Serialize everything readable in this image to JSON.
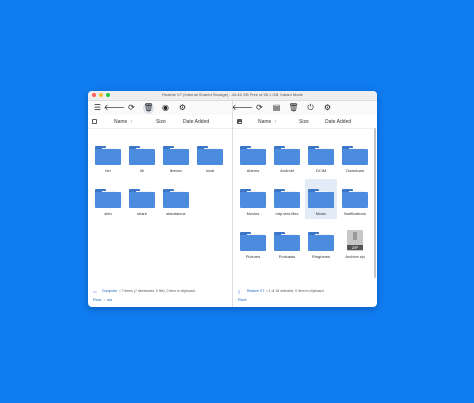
{
  "window": {
    "title": "Realme X7 (Internal Shared Storage) - 44.46 GB Free of 55.1 GB, Kalam Mode",
    "traffic_colors": [
      "#fe5f57",
      "#febc2e",
      "#28c840"
    ]
  },
  "left": {
    "header": {
      "name": "Name",
      "size": "Size",
      "date": "Date Added"
    },
    "items": [
      {
        "label": "bin",
        "kind": "folder"
      },
      {
        "label": "lib",
        "kind": "folder"
      },
      {
        "label": "libexec",
        "kind": "folder"
      },
      {
        "label": "local",
        "kind": "folder"
      },
      {
        "label": "sbin",
        "kind": "folder"
      },
      {
        "label": "share",
        "kind": "folder"
      },
      {
        "label": "standalone",
        "kind": "folder"
      }
    ],
    "status": {
      "source": "Computer",
      "text": "• 7 items (7 directories, 0 file), 0 item in clipboard"
    },
    "breadcrumb": {
      "root": "Root",
      "sep": "›",
      "current": "usr"
    }
  },
  "right": {
    "header": {
      "name": "Name",
      "size": "Size",
      "date": "Date Added"
    },
    "items": [
      {
        "label": "Alarms",
        "kind": "folder"
      },
      {
        "label": "Android",
        "kind": "folder"
      },
      {
        "label": "DCIM",
        "kind": "folder"
      },
      {
        "label": "Download",
        "kind": "folder"
      },
      {
        "label": "Movies",
        "kind": "folder"
      },
      {
        "label": "mtp-test-files",
        "kind": "folder"
      },
      {
        "label": "Music",
        "kind": "folder",
        "selected": true
      },
      {
        "label": "Notifications",
        "kind": "folder"
      },
      {
        "label": "Pictures",
        "kind": "folder"
      },
      {
        "label": "Podcasts",
        "kind": "folder"
      },
      {
        "label": "Ringtones",
        "kind": "folder"
      },
      {
        "label": "Archive.zip",
        "kind": "zip",
        "badge": "ZIP"
      }
    ],
    "status": {
      "source": "Realme X7",
      "text": "• 1 of 16 selected, 0 item in clipboard"
    },
    "breadcrumb": {
      "root": "Root"
    }
  },
  "icons": {
    "menu": "☰",
    "back": "🡐",
    "refresh": "⟳",
    "trash": "🗑",
    "github": "◉",
    "settings": "⚙",
    "sd": "▤",
    "plug": "⏻",
    "sort": "↑",
    "computer": "▭",
    "phone": "▯"
  },
  "colors": {
    "accent": "#1a5fbf",
    "folder": "#4c8cdf",
    "folder_tab": "#3b76c9",
    "background": "#0f7cf1"
  }
}
